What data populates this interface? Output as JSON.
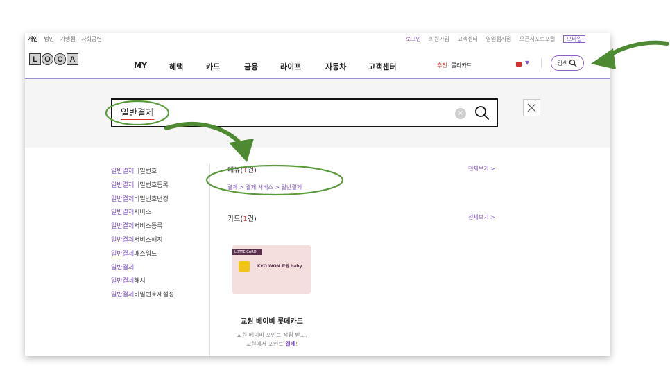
{
  "utility": {
    "left_links": [
      "개인",
      "법인",
      "가맹점",
      "사회공헌"
    ],
    "right_links": [
      "로그인",
      "회원가입",
      "고객센터",
      "영업점지점",
      "오픈서포트포털",
      "모바일"
    ]
  },
  "gnb": {
    "logo_letters": [
      "L",
      "O",
      "C",
      "A"
    ],
    "nav": [
      "MY",
      "혜택",
      "카드",
      "금융",
      "라이프",
      "자동차",
      "고객센터"
    ],
    "recommend_tag": "추천",
    "recommend_text": "롤라카드",
    "search_label": "검색"
  },
  "search": {
    "query": "일반결제",
    "clear_glyph": "×"
  },
  "suggestions": [
    {
      "hl": "일반결제",
      "rest": "비밀번호"
    },
    {
      "hl": "일반결제",
      "rest": "비밀번호등록"
    },
    {
      "hl": "일반결제",
      "rest": "비밀번호변경"
    },
    {
      "hl": "일반결제",
      "rest": "서비스"
    },
    {
      "hl": "일반결제",
      "rest": "서비스등록"
    },
    {
      "hl": "일반결제",
      "rest": "서비스해지"
    },
    {
      "hl": "일반결제",
      "rest": "패스워드"
    },
    {
      "hl": "일반결제",
      "rest": ""
    },
    {
      "hl": "일반결제",
      "rest": "해지"
    },
    {
      "hl": "일반결제",
      "rest": "비밀번호재설정"
    }
  ],
  "menu_section": {
    "title": "메뉴",
    "count_open": "(",
    "count": "1",
    "count_close": "건)",
    "view_all": "전체보기 >",
    "path": "결제 > 결제 서비스 > 일반결제"
  },
  "card_section": {
    "title": "카드",
    "count_open": "(",
    "count": "1",
    "count_close": "건)",
    "view_all": "전체보기 >",
    "card_bar_text": "LOTTE CARD",
    "card_brand": "KYO WON 교원 baby",
    "card_name": "교원 베이비 롯데카드",
    "desc_line1": "교원 베이비 포인트 적립 받고,",
    "desc_line2_pre": "교원에서 포인트 ",
    "desc_line2_hl": "결제",
    "desc_line2_post": "!"
  },
  "colors": {
    "accent": "#8b5fc6",
    "highlight": "#7b4fc0",
    "count_red": "#dd3333",
    "annotation_green": "#5a9a3a"
  }
}
